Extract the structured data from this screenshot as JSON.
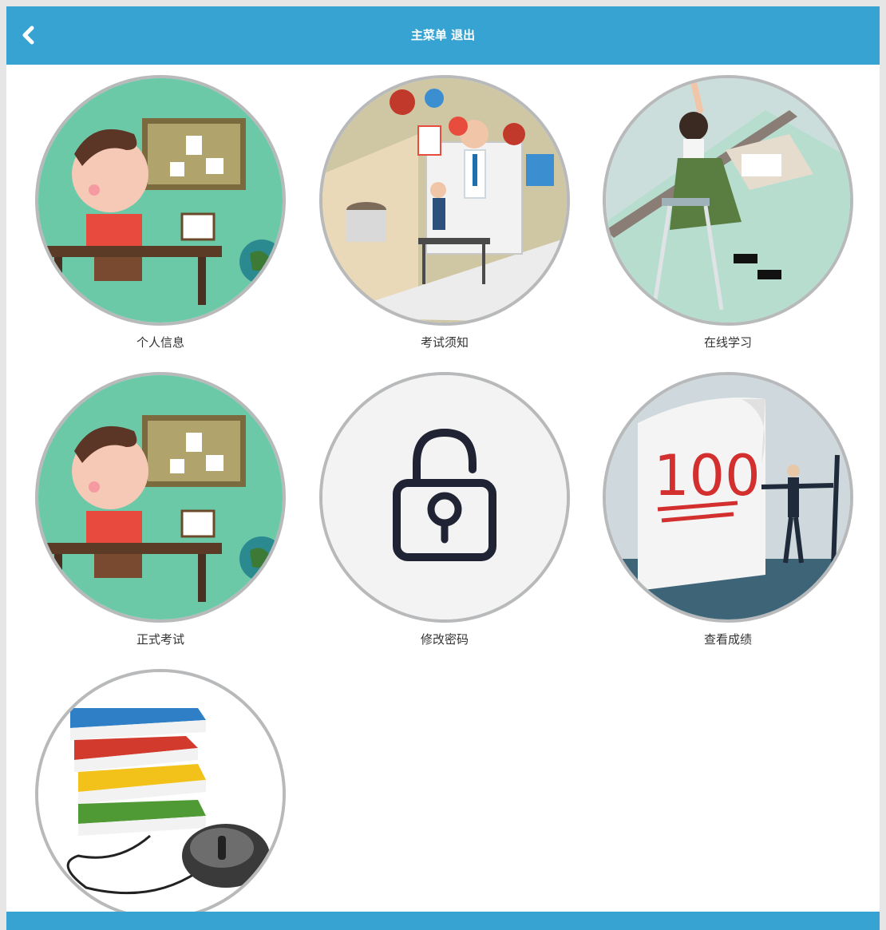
{
  "header": {
    "title": "主菜单",
    "logout_label": "退出",
    "back_icon": "chevron-left-icon"
  },
  "menu": [
    {
      "label": "个人信息",
      "illustration": "boy-at-desk-icon"
    },
    {
      "label": "考试须知",
      "illustration": "online-teacher-icon"
    },
    {
      "label": "在线学习",
      "illustration": "student-writing-icon"
    },
    {
      "label": "正式考试",
      "illustration": "boy-at-desk-icon"
    },
    {
      "label": "修改密码",
      "illustration": "padlock-icon"
    },
    {
      "label": "查看成绩",
      "illustration": "score-100-icon"
    },
    {
      "label": "",
      "illustration": "books-and-mouse-icon"
    }
  ],
  "colors": {
    "header": "#36a3d3",
    "circle_border": "#b7b9ba",
    "label": "#333333"
  }
}
